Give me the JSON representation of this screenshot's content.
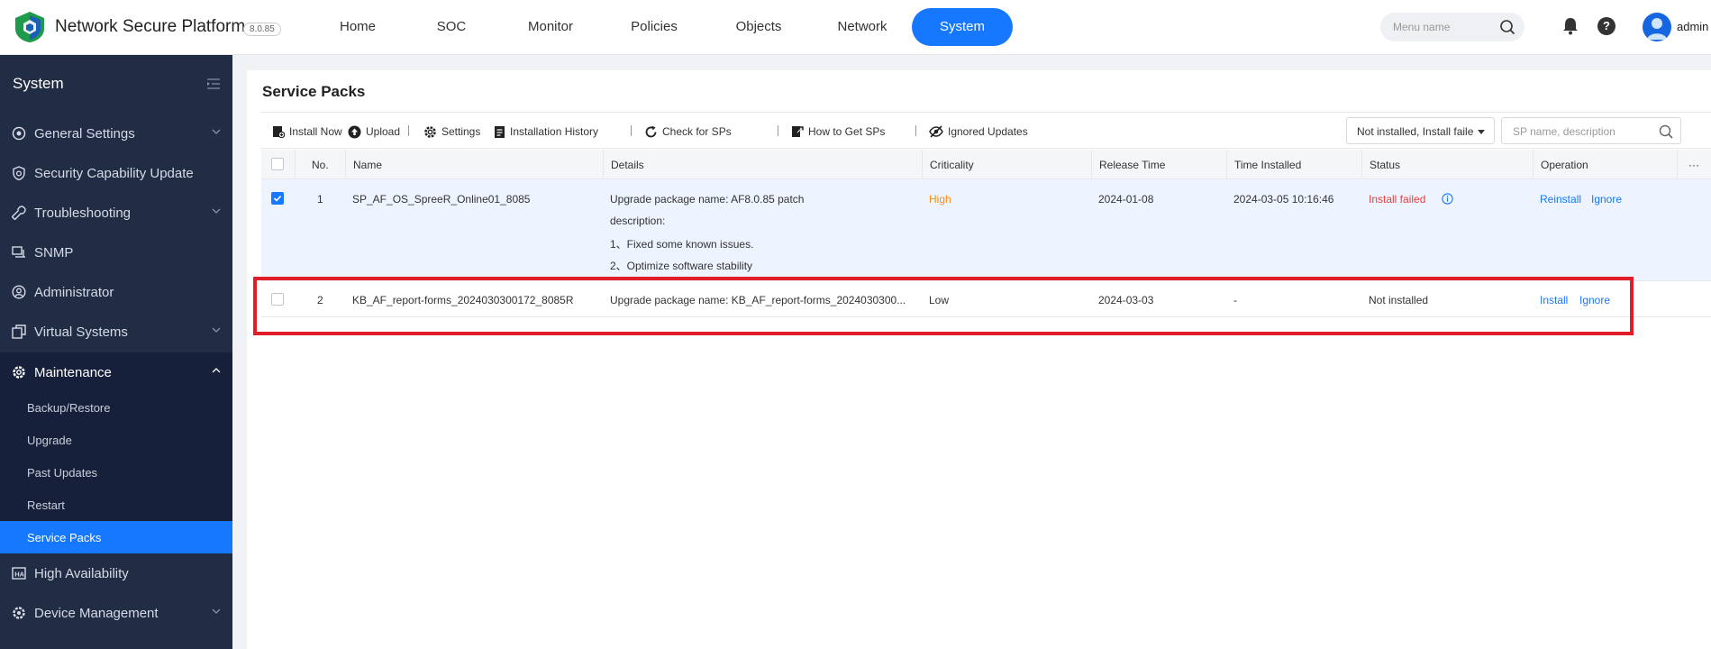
{
  "app": {
    "title": "Network Secure Platform",
    "version": "8.0.85",
    "nav": [
      "Home",
      "SOC",
      "Monitor",
      "Policies",
      "Objects",
      "Network",
      "System"
    ],
    "active_nav": "System",
    "menu_search_placeholder": "Menu name",
    "user": "admin"
  },
  "sidebar": {
    "title": "System",
    "items": [
      {
        "label": "General Settings",
        "icon": "gear-circle-icon",
        "expandable": true
      },
      {
        "label": "Security Capability Update",
        "icon": "shield-refresh-icon",
        "expandable": false
      },
      {
        "label": "Troubleshooting",
        "icon": "wrench-icon",
        "expandable": true
      },
      {
        "label": "SNMP",
        "icon": "snmp-icon",
        "expandable": false
      },
      {
        "label": "Administrator",
        "icon": "user-circle-icon",
        "expandable": false
      },
      {
        "label": "Virtual Systems",
        "icon": "virtual-system-icon",
        "expandable": true
      },
      {
        "label": "Maintenance",
        "icon": "maintenance-gear-icon",
        "expandable": true,
        "open": true
      },
      {
        "label": "High Availability",
        "icon": "ha-icon",
        "expandable": false
      },
      {
        "label": "Device Management",
        "icon": "device-gear-icon",
        "expandable": true
      }
    ],
    "maintenance_sub": [
      "Backup/Restore",
      "Upgrade",
      "Past Updates",
      "Restart",
      "Service Packs"
    ],
    "active_sub": "Service Packs"
  },
  "page": {
    "title": "Service Packs",
    "toolbar": {
      "install_now": "Install Now",
      "upload": "Upload",
      "settings": "Settings",
      "installation_history": "Installation History",
      "check_for_sps": "Check for SPs",
      "how_to_get_sps": "How to Get SPs",
      "ignored_updates": "Ignored Updates",
      "filter_value": "Not installed, Install failed, Ro",
      "search_placeholder": "SP name, description"
    },
    "columns": {
      "no": "No.",
      "name": "Name",
      "details": "Details",
      "criticality": "Criticality",
      "release_time": "Release Time",
      "time_installed": "Time Installed",
      "status": "Status",
      "operation": "Operation",
      "more": "···"
    },
    "rows": [
      {
        "no": "1",
        "name": "SP_AF_OS_SpreeR_Online01_8085",
        "details": [
          "Upgrade package name: AF8.0.85 patch",
          "description:",
          "1、Fixed some known issues.",
          "2、Optimize software stability"
        ],
        "criticality": "High",
        "release_time": "2024-01-08",
        "time_installed": "2024-03-05 10:16:46",
        "status": "Install failed",
        "actions": [
          "Reinstall",
          "Ignore"
        ],
        "checked": true
      },
      {
        "no": "2",
        "name": "KB_AF_report-forms_2024030300172_8085R",
        "details": [
          "Upgrade package name: KB_AF_report-forms_2024030300..."
        ],
        "criticality": "Low",
        "release_time": "2024-03-03",
        "time_installed": "-",
        "status": "Not installed",
        "actions": [
          "Install",
          "Ignore"
        ],
        "checked": false
      }
    ]
  },
  "colors": {
    "primary": "#1677ff",
    "sidebar_bg": "#212c45",
    "high": "#fa8c16",
    "fail": "#e8413d",
    "highlight": "#e11d2a"
  }
}
